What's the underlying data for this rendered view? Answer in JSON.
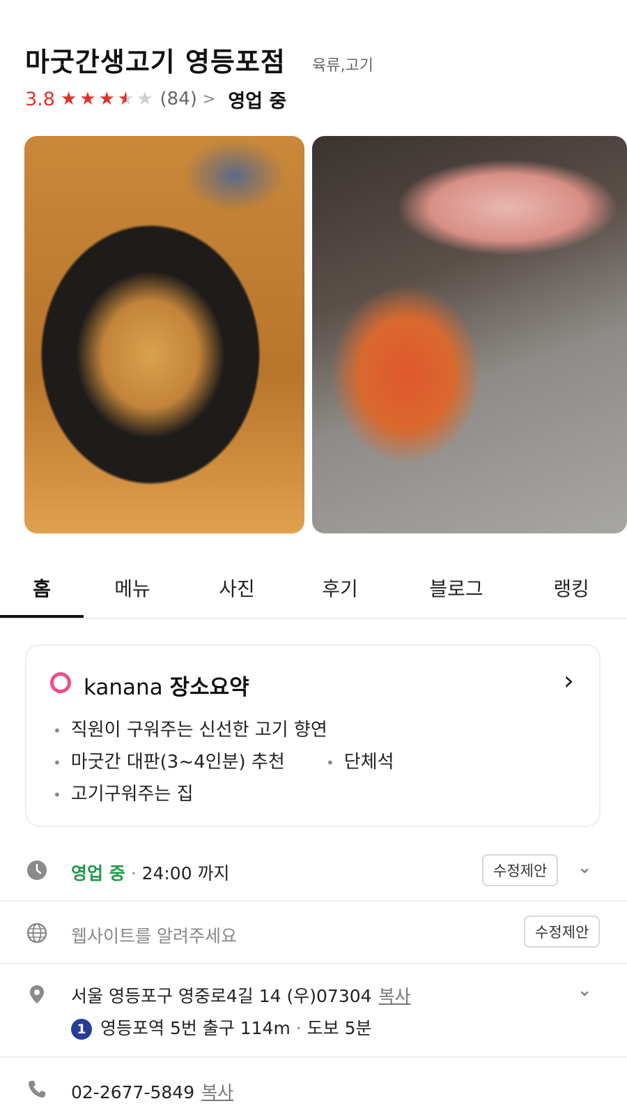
{
  "header": {
    "title": "마굿간생고기 영등포점",
    "category": "육류,고기",
    "rating": "3.8",
    "rating_value": 3.8,
    "rating_max": 5,
    "review_count": "(84)",
    "open_status": "영업 중"
  },
  "photos": [
    {
      "icon": "food-photo-stew"
    },
    {
      "icon": "food-photo-grill"
    }
  ],
  "tabs": [
    "홈",
    "메뉴",
    "사진",
    "후기",
    "블로그",
    "랭킹"
  ],
  "active_tab": "홈",
  "summary_card": {
    "brand": "kanana",
    "title": "장소요약",
    "items": [
      "직원이 구워주는 신선한 고기 향연",
      "마굿간 대판(3~4인분) 추천",
      "단체석",
      "고기구워주는 집"
    ]
  },
  "info": {
    "hours": {
      "status": "영업 중",
      "until": "24:00 까지",
      "suggest_label": "수정제안"
    },
    "website": {
      "placeholder": "웹사이트를 알려주세요",
      "suggest_label": "수정제안"
    },
    "address": {
      "text": "서울 영등포구 영중로4길 14 (우)07304",
      "copy_label": "복사",
      "subway_line": "1",
      "subway_text": "영등포역 5번 출구 114m",
      "walk_text": "도보 5분"
    },
    "phone": {
      "number": "02-2677-5849",
      "copy_label": "복사"
    }
  },
  "colors": {
    "rating_red": "#e0322d",
    "open_green": "#1f9a48",
    "kanana_pink": "#f04b8a",
    "subway_line1": "#263c96"
  }
}
